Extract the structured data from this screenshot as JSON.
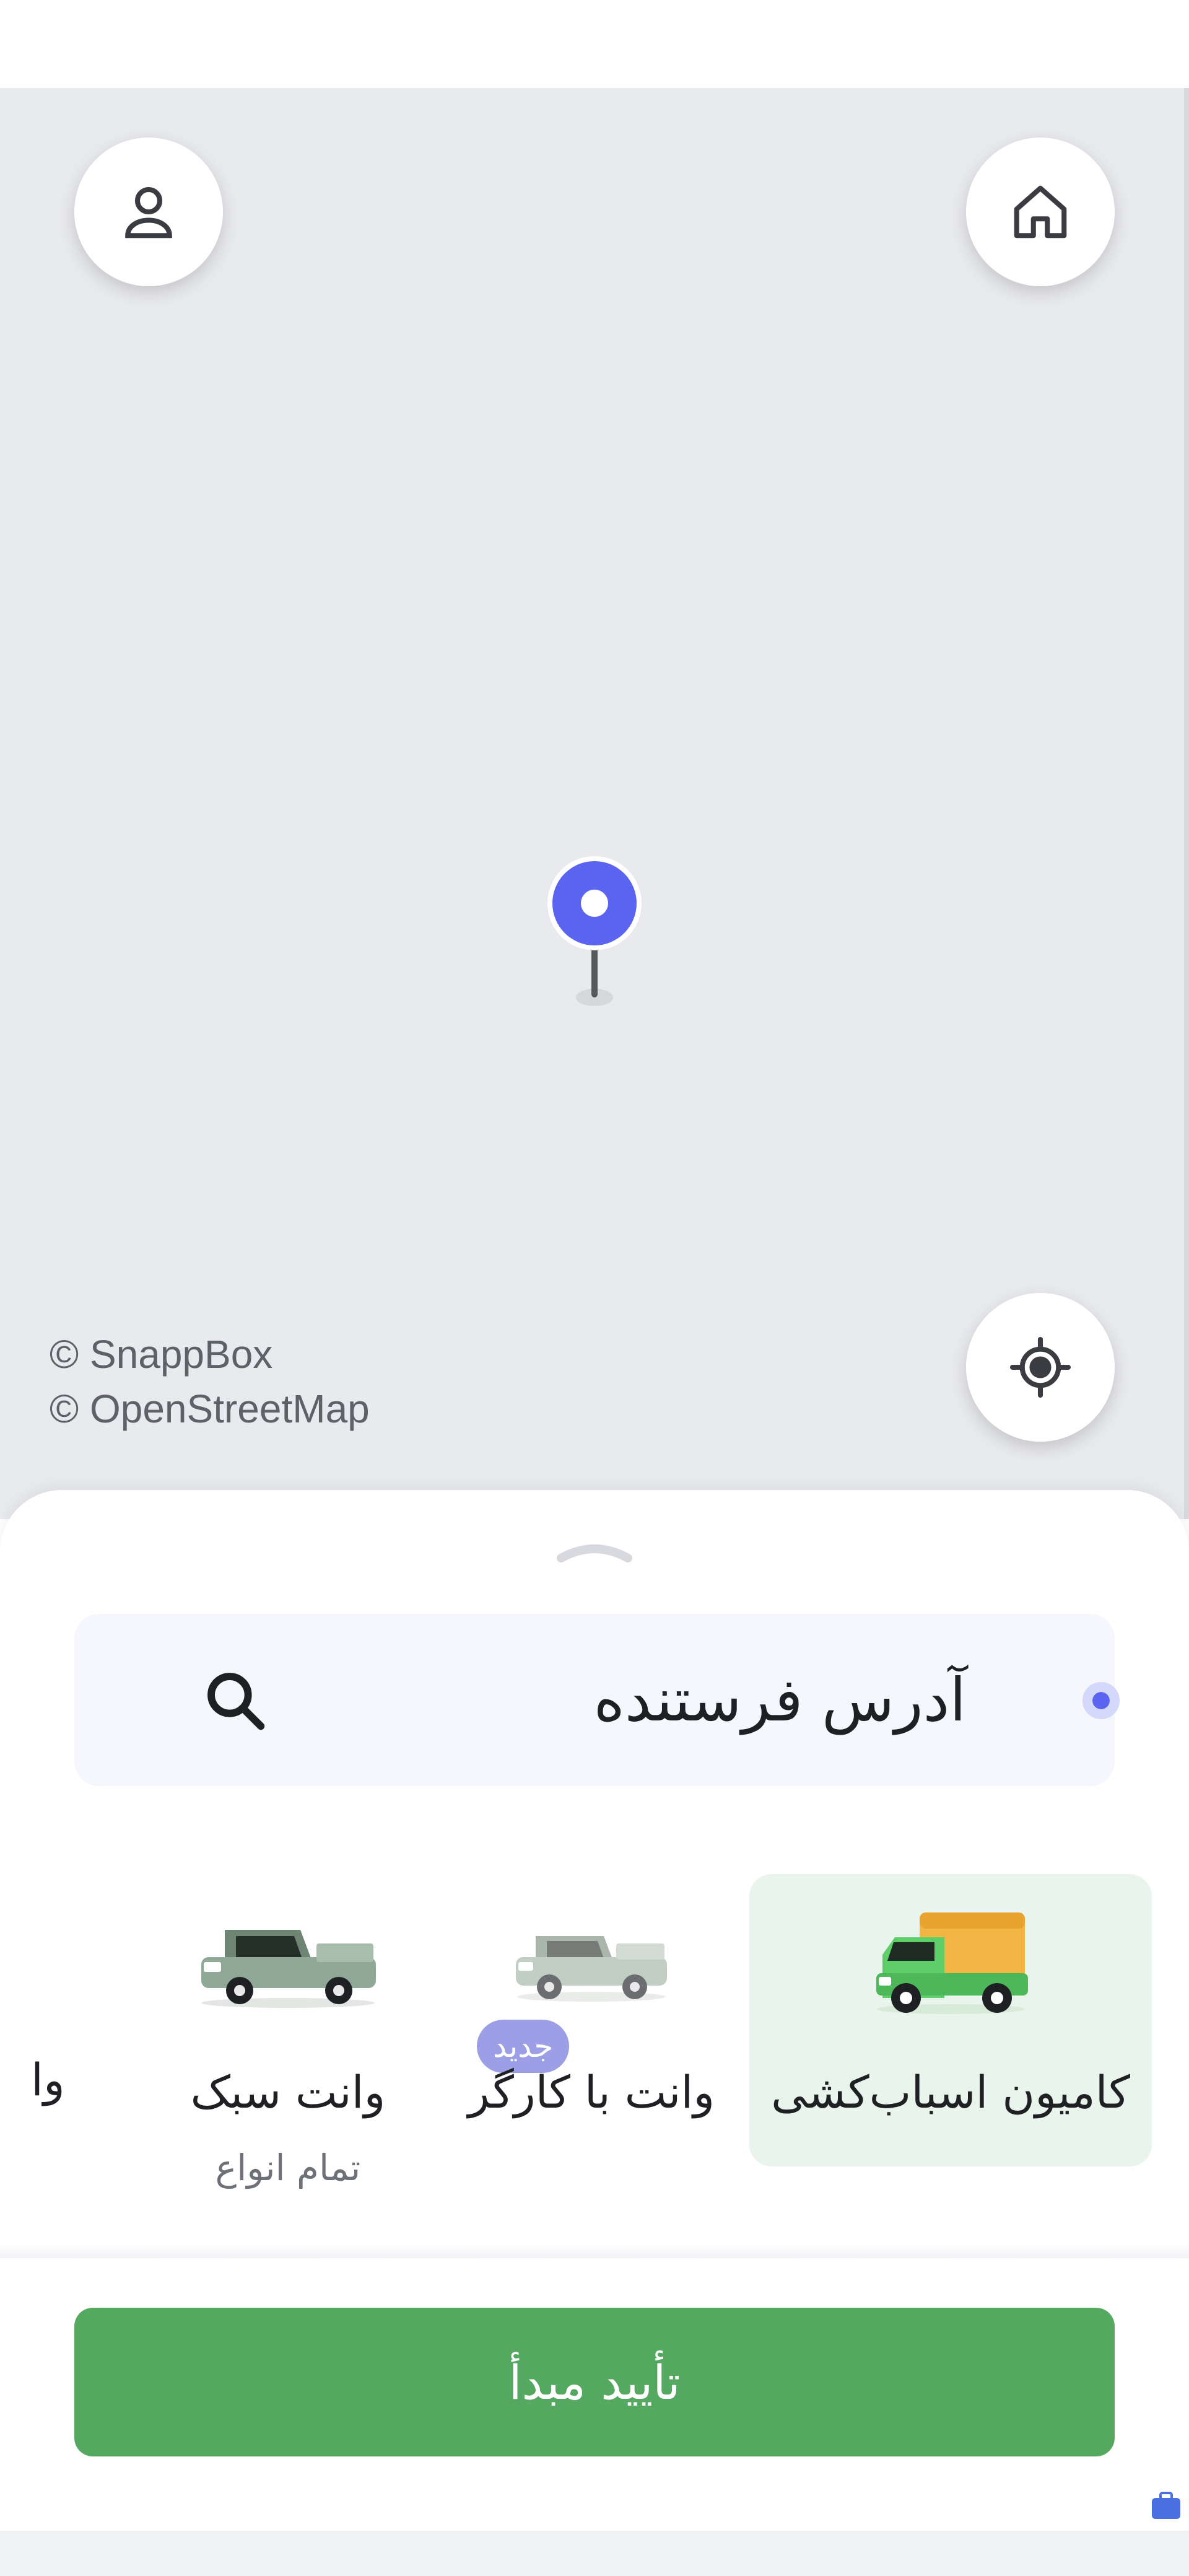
{
  "map": {
    "attribution": [
      "© SnappBox",
      "© OpenStreetMap"
    ],
    "profile_icon": "person-icon",
    "home_icon": "home-icon",
    "locate_icon": "crosshair-icon",
    "pin_color": "#5a64f0"
  },
  "sheet": {
    "search_label": "آدرس فرستنده",
    "search_icon": "search-icon",
    "vehicle_types": [
      {
        "name": "کامیون اسباب‌کشی",
        "selected": true
      },
      {
        "name": "وانت با کارگر",
        "badge": "جدید"
      },
      {
        "name": "وانت سبک",
        "sub": "تمام انواع"
      },
      {
        "name": "وا"
      }
    ]
  },
  "footer": {
    "confirm_label": "تأیید مبدأ",
    "button_color": "#55a860"
  }
}
